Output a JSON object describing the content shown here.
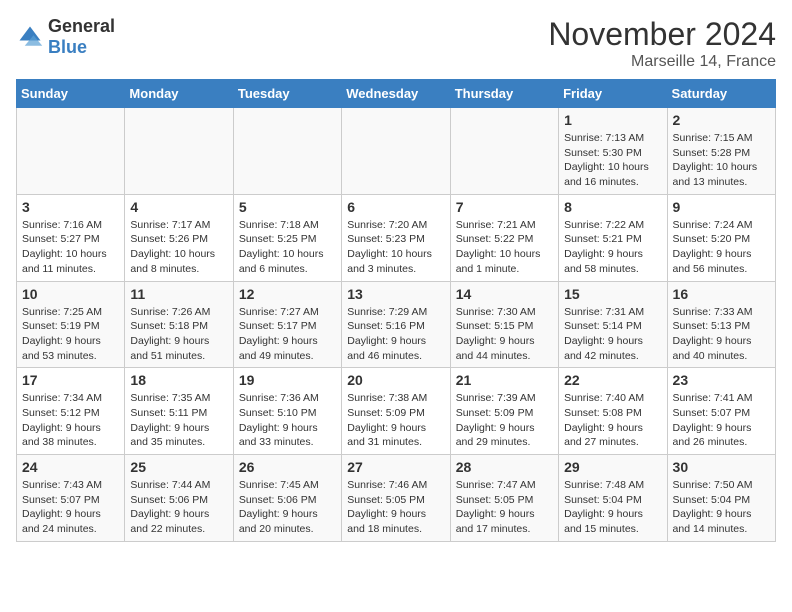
{
  "logo": {
    "general": "General",
    "blue": "Blue"
  },
  "title": "November 2024",
  "location": "Marseille 14, France",
  "days_of_week": [
    "Sunday",
    "Monday",
    "Tuesday",
    "Wednesday",
    "Thursday",
    "Friday",
    "Saturday"
  ],
  "weeks": [
    [
      {
        "day": "",
        "text": ""
      },
      {
        "day": "",
        "text": ""
      },
      {
        "day": "",
        "text": ""
      },
      {
        "day": "",
        "text": ""
      },
      {
        "day": "",
        "text": ""
      },
      {
        "day": "1",
        "text": "Sunrise: 7:13 AM\nSunset: 5:30 PM\nDaylight: 10 hours\nand 16 minutes."
      },
      {
        "day": "2",
        "text": "Sunrise: 7:15 AM\nSunset: 5:28 PM\nDaylight: 10 hours\nand 13 minutes."
      }
    ],
    [
      {
        "day": "3",
        "text": "Sunrise: 7:16 AM\nSunset: 5:27 PM\nDaylight: 10 hours\nand 11 minutes."
      },
      {
        "day": "4",
        "text": "Sunrise: 7:17 AM\nSunset: 5:26 PM\nDaylight: 10 hours\nand 8 minutes."
      },
      {
        "day": "5",
        "text": "Sunrise: 7:18 AM\nSunset: 5:25 PM\nDaylight: 10 hours\nand 6 minutes."
      },
      {
        "day": "6",
        "text": "Sunrise: 7:20 AM\nSunset: 5:23 PM\nDaylight: 10 hours\nand 3 minutes."
      },
      {
        "day": "7",
        "text": "Sunrise: 7:21 AM\nSunset: 5:22 PM\nDaylight: 10 hours\nand 1 minute."
      },
      {
        "day": "8",
        "text": "Sunrise: 7:22 AM\nSunset: 5:21 PM\nDaylight: 9 hours\nand 58 minutes."
      },
      {
        "day": "9",
        "text": "Sunrise: 7:24 AM\nSunset: 5:20 PM\nDaylight: 9 hours\nand 56 minutes."
      }
    ],
    [
      {
        "day": "10",
        "text": "Sunrise: 7:25 AM\nSunset: 5:19 PM\nDaylight: 9 hours\nand 53 minutes."
      },
      {
        "day": "11",
        "text": "Sunrise: 7:26 AM\nSunset: 5:18 PM\nDaylight: 9 hours\nand 51 minutes."
      },
      {
        "day": "12",
        "text": "Sunrise: 7:27 AM\nSunset: 5:17 PM\nDaylight: 9 hours\nand 49 minutes."
      },
      {
        "day": "13",
        "text": "Sunrise: 7:29 AM\nSunset: 5:16 PM\nDaylight: 9 hours\nand 46 minutes."
      },
      {
        "day": "14",
        "text": "Sunrise: 7:30 AM\nSunset: 5:15 PM\nDaylight: 9 hours\nand 44 minutes."
      },
      {
        "day": "15",
        "text": "Sunrise: 7:31 AM\nSunset: 5:14 PM\nDaylight: 9 hours\nand 42 minutes."
      },
      {
        "day": "16",
        "text": "Sunrise: 7:33 AM\nSunset: 5:13 PM\nDaylight: 9 hours\nand 40 minutes."
      }
    ],
    [
      {
        "day": "17",
        "text": "Sunrise: 7:34 AM\nSunset: 5:12 PM\nDaylight: 9 hours\nand 38 minutes."
      },
      {
        "day": "18",
        "text": "Sunrise: 7:35 AM\nSunset: 5:11 PM\nDaylight: 9 hours\nand 35 minutes."
      },
      {
        "day": "19",
        "text": "Sunrise: 7:36 AM\nSunset: 5:10 PM\nDaylight: 9 hours\nand 33 minutes."
      },
      {
        "day": "20",
        "text": "Sunrise: 7:38 AM\nSunset: 5:09 PM\nDaylight: 9 hours\nand 31 minutes."
      },
      {
        "day": "21",
        "text": "Sunrise: 7:39 AM\nSunset: 5:09 PM\nDaylight: 9 hours\nand 29 minutes."
      },
      {
        "day": "22",
        "text": "Sunrise: 7:40 AM\nSunset: 5:08 PM\nDaylight: 9 hours\nand 27 minutes."
      },
      {
        "day": "23",
        "text": "Sunrise: 7:41 AM\nSunset: 5:07 PM\nDaylight: 9 hours\nand 26 minutes."
      }
    ],
    [
      {
        "day": "24",
        "text": "Sunrise: 7:43 AM\nSunset: 5:07 PM\nDaylight: 9 hours\nand 24 minutes."
      },
      {
        "day": "25",
        "text": "Sunrise: 7:44 AM\nSunset: 5:06 PM\nDaylight: 9 hours\nand 22 minutes."
      },
      {
        "day": "26",
        "text": "Sunrise: 7:45 AM\nSunset: 5:06 PM\nDaylight: 9 hours\nand 20 minutes."
      },
      {
        "day": "27",
        "text": "Sunrise: 7:46 AM\nSunset: 5:05 PM\nDaylight: 9 hours\nand 18 minutes."
      },
      {
        "day": "28",
        "text": "Sunrise: 7:47 AM\nSunset: 5:05 PM\nDaylight: 9 hours\nand 17 minutes."
      },
      {
        "day": "29",
        "text": "Sunrise: 7:48 AM\nSunset: 5:04 PM\nDaylight: 9 hours\nand 15 minutes."
      },
      {
        "day": "30",
        "text": "Sunrise: 7:50 AM\nSunset: 5:04 PM\nDaylight: 9 hours\nand 14 minutes."
      }
    ]
  ]
}
